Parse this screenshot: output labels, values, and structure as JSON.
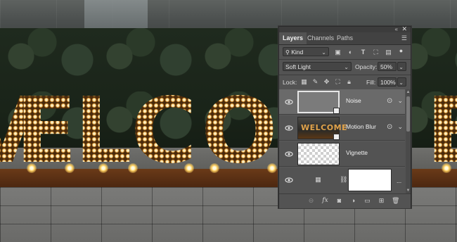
{
  "scene": {
    "marquee_letters": [
      "V",
      "E",
      "L",
      "C",
      "O",
      "E"
    ]
  },
  "panel": {
    "tabs": [
      {
        "label": "Layers",
        "active": true
      },
      {
        "label": "Channels",
        "active": false
      },
      {
        "label": "Paths",
        "active": false
      }
    ],
    "filter": {
      "label": "Kind"
    },
    "blend_mode": "Soft Light",
    "opacity_label": "Opacity:",
    "opacity_value": "50%",
    "lock_label": "Lock:",
    "fill_label": "Fill:",
    "fill_value": "100%",
    "layers": [
      {
        "name": "Noise",
        "selected": true,
        "thumb": "gray",
        "smart": true,
        "has_fx": true
      },
      {
        "name": "Motion Blur",
        "selected": false,
        "thumb": "welcome",
        "thumb_text": "WELCOME",
        "smart": true,
        "has_fx": true
      },
      {
        "name": "Vignette",
        "selected": false,
        "thumb": "transparent",
        "smart": false,
        "has_fx": false
      },
      {
        "name": "",
        "selected": false,
        "thumb": "adjustment-mask",
        "smart": false,
        "has_fx": false,
        "more": "..."
      }
    ],
    "footer_icons": [
      "link-icon",
      "fx-icon",
      "mask-icon",
      "adjustment-icon",
      "folder-icon",
      "new-layer-icon",
      "trash-icon"
    ],
    "fx_label": "fx"
  }
}
